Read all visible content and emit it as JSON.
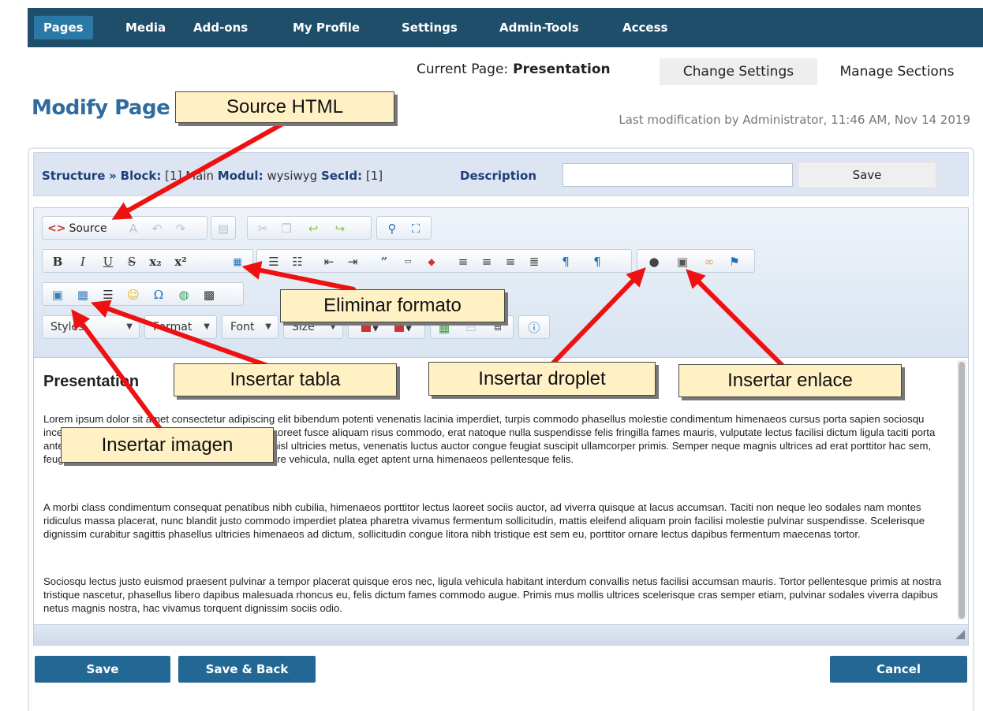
{
  "nav": {
    "items": [
      "Pages",
      "Media",
      "Add-ons",
      "My Profile",
      "Settings",
      "Admin-Tools",
      "Access"
    ]
  },
  "header": {
    "current_label": "Current Page:",
    "current_page": "Presentation",
    "change_settings": "Change Settings",
    "manage_sections": "Manage Sections",
    "title": "Modify Page",
    "last_modification": "Last modification by Administrator, 11:46 AM, Nov 14 2019"
  },
  "structure": {
    "structure_label": "Structure",
    "sep": "»",
    "block_label": "Block:",
    "block_value": "[1] Main",
    "modul_label": "Modul:",
    "modul_value": "wysiwyg",
    "secid_label": "SecId:",
    "secid_value": "[1]",
    "description_label": "Description",
    "description_value": "",
    "save_label": "Save"
  },
  "toolbar": {
    "source_label": "Source",
    "styles_label": "Styles",
    "format_label": "Format",
    "font_label": "Font",
    "size_label": "Size"
  },
  "content": {
    "heading": "Presentation",
    "paragraphs": [
      "Lorem ipsum dolor sit amet consectetur adipiscing elit bibendum potenti venenatis lacinia imperdiet, turpis commodo phasellus molestie condimentum himenaeos cursus porta sapien sociosqu inceptos habitasse sagittis enim himenaeos nibh laoreet fusce aliquam risus commodo, erat natoque nulla suspendisse felis fringilla fames mauris, vulputate lectus facilisi dictum ligula taciti porta ante faucibus eros. Magnis vulputate nibh viverra nisl ultricies metus, venenatis luctus auctor congue feugiat suscipit ullamcorper primis. Semper neque magnis ultrices ad erat porttitor hac sem, feugiat vitae enim velit cras sociis scelerisque ornare vehicula, nulla eget aptent urna himenaeos pellentesque felis.",
      "A morbi class condimentum consequat penatibus nibh cubilia, himenaeos porttitor lectus laoreet sociis auctor, ad viverra quisque at lacus accumsan. Taciti non neque leo sodales nam montes ridiculus massa placerat, nunc blandit justo commodo imperdiet platea pharetra vivamus fermentum sollicitudin, mattis eleifend aliquam proin facilisi molestie pulvinar suspendisse. Scelerisque dignissim curabitur sagittis phasellus ultricies himenaeos ad dictum, sollicitudin congue litora nibh tristique est sem eu, porttitor ornare lectus dapibus fermentum maecenas tortor.",
      "Sociosqu lectus justo euismod praesent pulvinar a tempor placerat quisque eros nec, ligula vehicula habitant interdum convallis netus facilisi accumsan mauris. Tortor pellentesque primis at nostra tristique nascetur, phasellus libero dapibus malesuada rhoncus eu, felis dictum fames commodo augue. Primis mus mollis ultrices scelerisque cras semper etiam, pulvinar sodales viverra dapibus netus magnis nostra, hac vivamus torquent dignissim sociis odio."
    ]
  },
  "buttons": {
    "save": "Save",
    "save_back": "Save & Back",
    "cancel": "Cancel"
  },
  "annotations": {
    "source_html": "Source HTML",
    "eliminar_formato": "Eliminar formato",
    "insertar_tabla": "Insertar tabla",
    "insertar_droplet": "Insertar droplet",
    "insertar_enlace": "Insertar enlace",
    "insertar_imagen": "Insertar imagen"
  },
  "colors": {
    "nav_bg": "#1f4e6b",
    "nav_active": "#2a78a6",
    "title_blue": "#2f6b9e",
    "button_blue": "#236894",
    "callout_bg": "#fff1c4",
    "arrow_red": "#ee1111"
  },
  "icons": {
    "row1": [
      "source-icon",
      "templates-icon",
      "undo-icon",
      "redo-icon",
      "paste-icon",
      "cut-icon",
      "copy-icon",
      "undo-arrow-icon",
      "redo-arrow-icon",
      "find-icon",
      "maximize-icon"
    ],
    "row2": [
      "bold-icon",
      "italic-icon",
      "underline-icon",
      "strike-icon",
      "subscript-icon",
      "superscript-icon",
      "remove-format-icon",
      "numbered-list-icon",
      "bullet-list-icon",
      "outdent-icon",
      "indent-icon",
      "blockquote-icon",
      "div-icon",
      "html-tag-icon",
      "align-left-icon",
      "align-center-icon",
      "align-right-icon",
      "justify-icon",
      "ltr-icon",
      "rtl-icon",
      "droplet-icon",
      "link-icon",
      "unlink-icon",
      "anchor-icon"
    ],
    "row3": [
      "image-icon",
      "table-icon",
      "horizontal-rule-icon",
      "smiley-icon",
      "omega-icon",
      "globe-icon",
      "iframe-icon"
    ],
    "row4": [
      "text-color-icon",
      "bg-color-icon",
      "show-blocks-icon",
      "page-break-icon",
      "code-icon",
      "about-icon"
    ]
  }
}
